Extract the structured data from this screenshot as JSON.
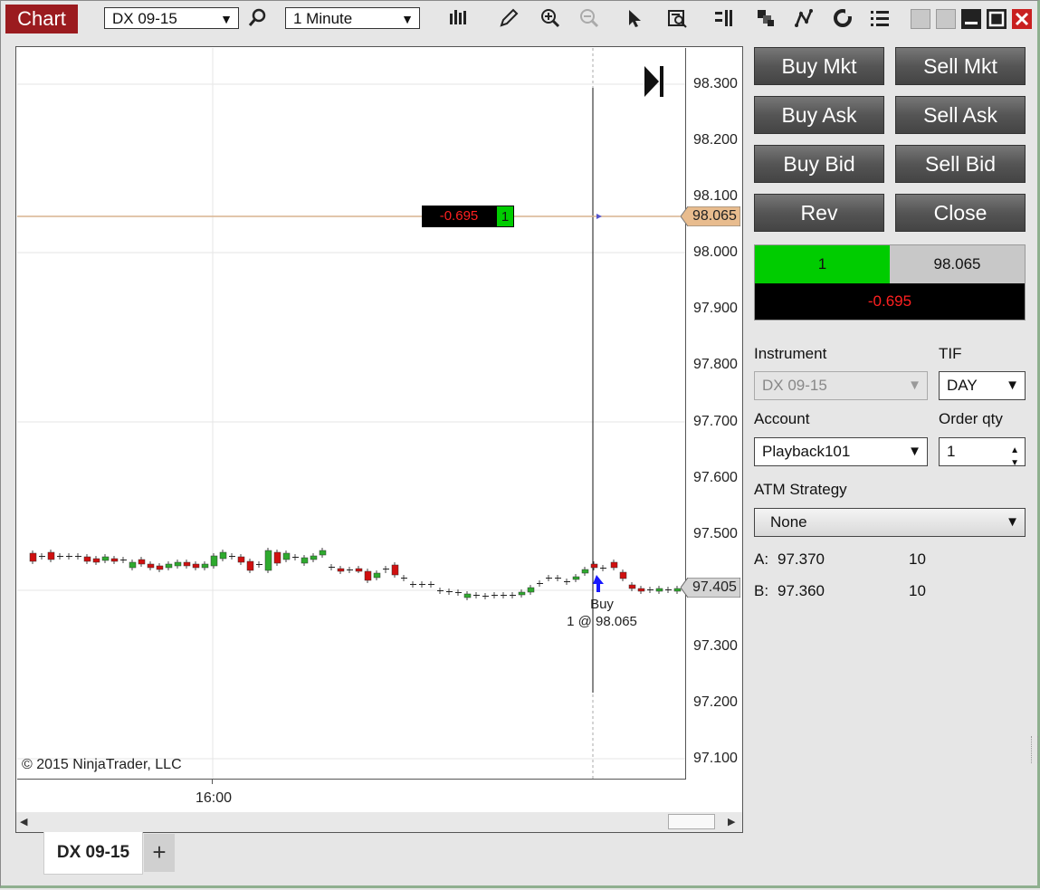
{
  "toolbar": {
    "chart_tab": "Chart",
    "instrument": "DX 09-15",
    "interval": "1 Minute"
  },
  "chart": {
    "price_labels": [
      "98.300",
      "98.200",
      "98.100",
      "98.000",
      "97.900",
      "97.800",
      "97.700",
      "97.600",
      "97.500",
      "97.300",
      "97.200",
      "97.100"
    ],
    "position_marker": {
      "pnl": "-0.695",
      "qty": "1",
      "price": "98.065"
    },
    "last_price": "97.405",
    "time_label": "16:00",
    "copyright": "© 2015 NinjaTrader, LLC",
    "execution": {
      "side": "Buy",
      "detail": "1 @ 98.065"
    }
  },
  "tabs": {
    "active": "DX 09-15",
    "add": "+"
  },
  "chart_trader": {
    "buttons": {
      "buy_mkt": "Buy Mkt",
      "sell_mkt": "Sell Mkt",
      "buy_ask": "Buy Ask",
      "sell_ask": "Sell Ask",
      "buy_bid": "Buy Bid",
      "sell_bid": "Sell Bid",
      "rev": "Rev",
      "close": "Close"
    },
    "position": {
      "qty": "1",
      "avg_price": "98.065",
      "pnl": "-0.695"
    },
    "instrument_label": "Instrument",
    "instrument_value": "DX 09-15",
    "tif_label": "TIF",
    "tif_value": "DAY",
    "account_label": "Account",
    "account_value": "Playback101",
    "order_qty_label": "Order qty",
    "order_qty_value": "1",
    "atm_label": "ATM Strategy",
    "atm_value": "None",
    "ask": {
      "label": "A:",
      "price": "97.370",
      "size": "10"
    },
    "bid": {
      "label": "B:",
      "price": "97.360",
      "size": "10"
    }
  },
  "colors": {
    "accent": "#9b1b1f",
    "up": "#2eaa2e",
    "down": "#d01010",
    "long": "#00cc00"
  }
}
